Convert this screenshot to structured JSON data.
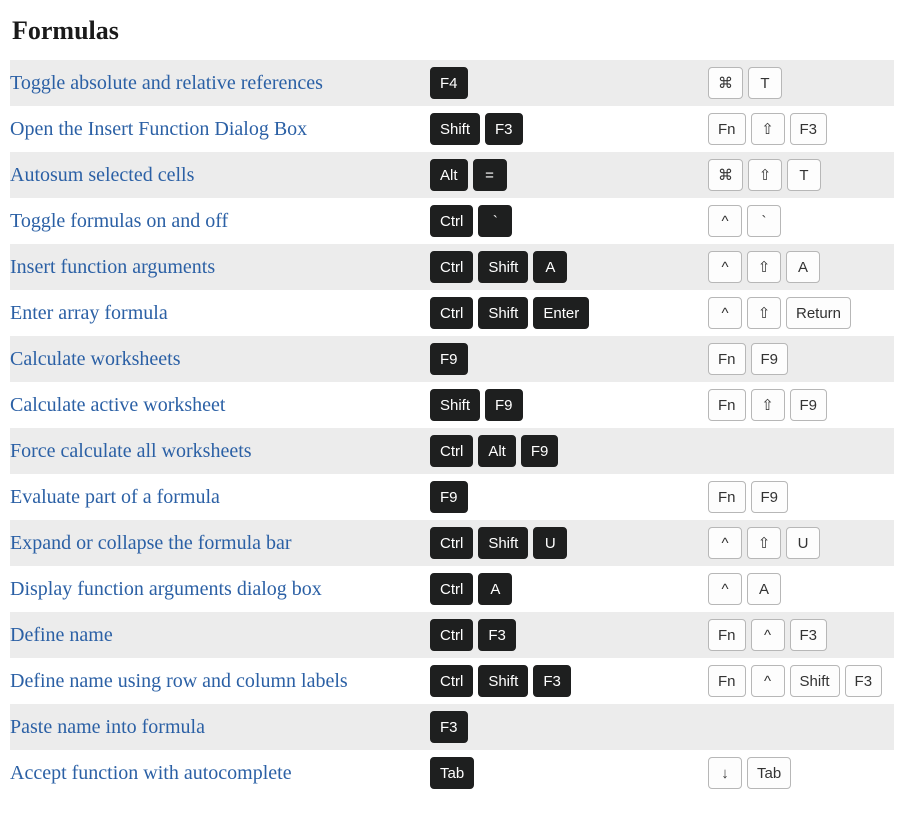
{
  "section": {
    "title": "Formulas"
  },
  "rows": [
    {
      "desc": "Toggle absolute and relative references",
      "win": [
        "F4"
      ],
      "mac": [
        "⌘",
        "T"
      ]
    },
    {
      "desc": "Open the Insert Function Dialog Box",
      "win": [
        "Shift",
        "F3"
      ],
      "mac": [
        "Fn",
        "⇧",
        "F3"
      ]
    },
    {
      "desc": "Autosum selected cells",
      "win": [
        "Alt",
        "="
      ],
      "mac": [
        "⌘",
        "⇧",
        "T"
      ]
    },
    {
      "desc": "Toggle formulas on and off",
      "win": [
        "Ctrl",
        "`"
      ],
      "mac": [
        "^",
        "`"
      ]
    },
    {
      "desc": "Insert function arguments",
      "win": [
        "Ctrl",
        "Shift",
        "A"
      ],
      "mac": [
        "^",
        "⇧",
        "A"
      ]
    },
    {
      "desc": "Enter array formula",
      "win": [
        "Ctrl",
        "Shift",
        "Enter"
      ],
      "mac": [
        "^",
        "⇧",
        "Return"
      ]
    },
    {
      "desc": "Calculate worksheets",
      "win": [
        "F9"
      ],
      "mac": [
        "Fn",
        "F9"
      ]
    },
    {
      "desc": "Calculate active worksheet",
      "win": [
        "Shift",
        "F9"
      ],
      "mac": [
        "Fn",
        "⇧",
        "F9"
      ]
    },
    {
      "desc": "Force calculate all worksheets",
      "win": [
        "Ctrl",
        "Alt",
        "F9"
      ],
      "mac": []
    },
    {
      "desc": "Evaluate part of a formula",
      "win": [
        "F9"
      ],
      "mac": [
        "Fn",
        "F9"
      ]
    },
    {
      "desc": "Expand or collapse the formula bar",
      "win": [
        "Ctrl",
        "Shift",
        "U"
      ],
      "mac": [
        "^",
        "⇧",
        "U"
      ]
    },
    {
      "desc": "Display function arguments dialog box",
      "win": [
        "Ctrl",
        "A"
      ],
      "mac": [
        "^",
        "A"
      ]
    },
    {
      "desc": "Define name",
      "win": [
        "Ctrl",
        "F3"
      ],
      "mac": [
        "Fn",
        "^",
        "F3"
      ]
    },
    {
      "desc": "Define name using row and column labels",
      "win": [
        "Ctrl",
        "Shift",
        "F3"
      ],
      "mac": [
        "Fn",
        "^",
        "Shift",
        "F3"
      ]
    },
    {
      "desc": "Paste name into formula",
      "win": [
        "F3"
      ],
      "mac": []
    },
    {
      "desc": "Accept function with autocomplete",
      "win": [
        "Tab"
      ],
      "mac": [
        "↓",
        "Tab"
      ]
    }
  ]
}
